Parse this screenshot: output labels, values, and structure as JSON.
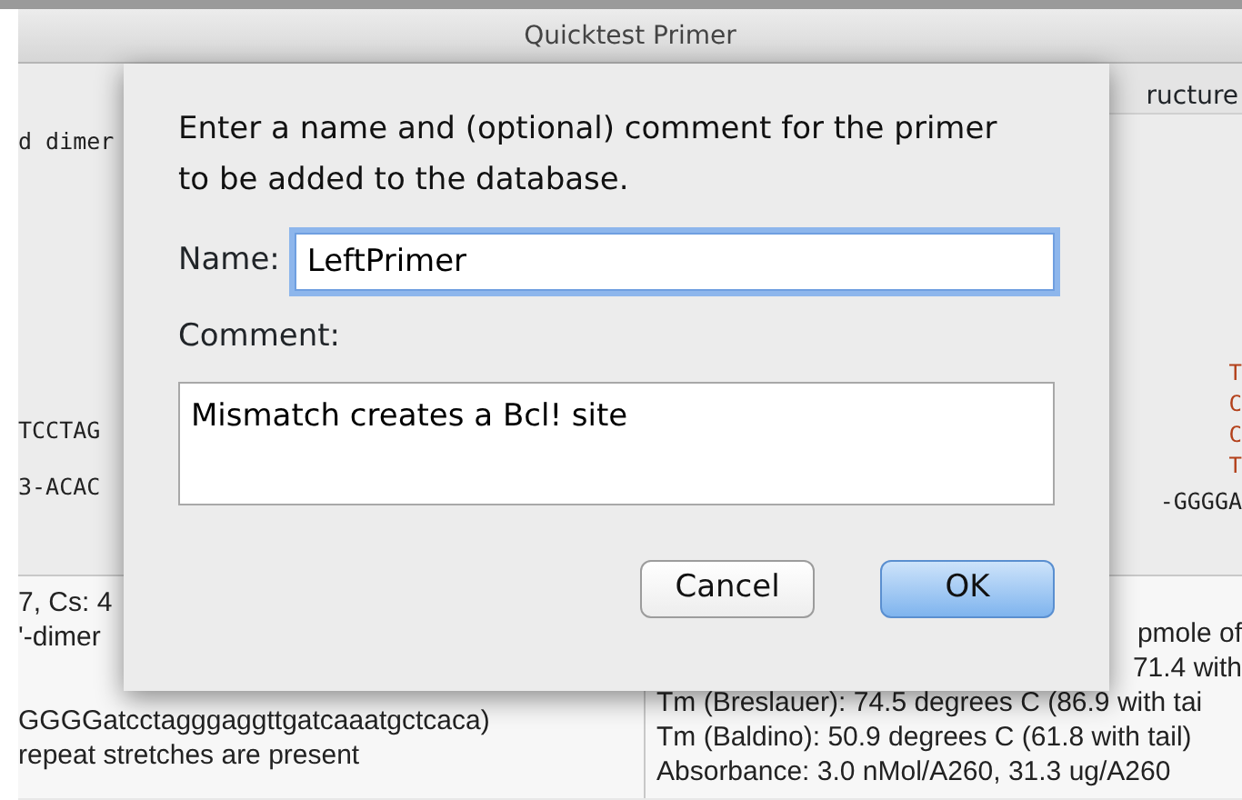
{
  "window": {
    "title": "Quicktest Primer"
  },
  "left_panel": {
    "top_lines": [
      "d dimer"
    ],
    "sequence_lines": [
      "TCCTAG",
      "3-ACAC"
    ],
    "info_lines": [
      "7, Cs: 4",
      "'-dimer",
      "GGGGatcctagggaggttgatcaaatgctcaca)",
      "repeat stretches are present"
    ]
  },
  "right_panel": {
    "header": "ructure",
    "sequence_letters": [
      "T",
      "C",
      "C",
      "T"
    ],
    "sequence_line": "-GGGGA",
    "info_lines": [
      {
        "kind": "tail",
        "text": "pmole of"
      },
      {
        "kind": "tail",
        "text": "71.4 with"
      },
      {
        "kind": "full",
        "text": "Tm (Breslauer): 74.5 degrees C (86.9 with tai"
      },
      {
        "kind": "full",
        "text": "Tm (Baldino): 50.9 degrees C (61.8 with tail)"
      },
      {
        "kind": "full",
        "text": "Absorbance: 3.0 nMol/A260, 31.3 ug/A260"
      }
    ]
  },
  "dialog": {
    "message": "Enter a name and (optional) comment for the primer to be added to the database.",
    "name": {
      "label": "Name:",
      "value": "LeftPrimer",
      "focused": true
    },
    "comment": {
      "label": "Comment:",
      "value": "Mismatch creates a Bcl! site"
    },
    "buttons": [
      {
        "label": "Cancel",
        "default": false
      },
      {
        "label": "OK",
        "default": true
      }
    ]
  }
}
